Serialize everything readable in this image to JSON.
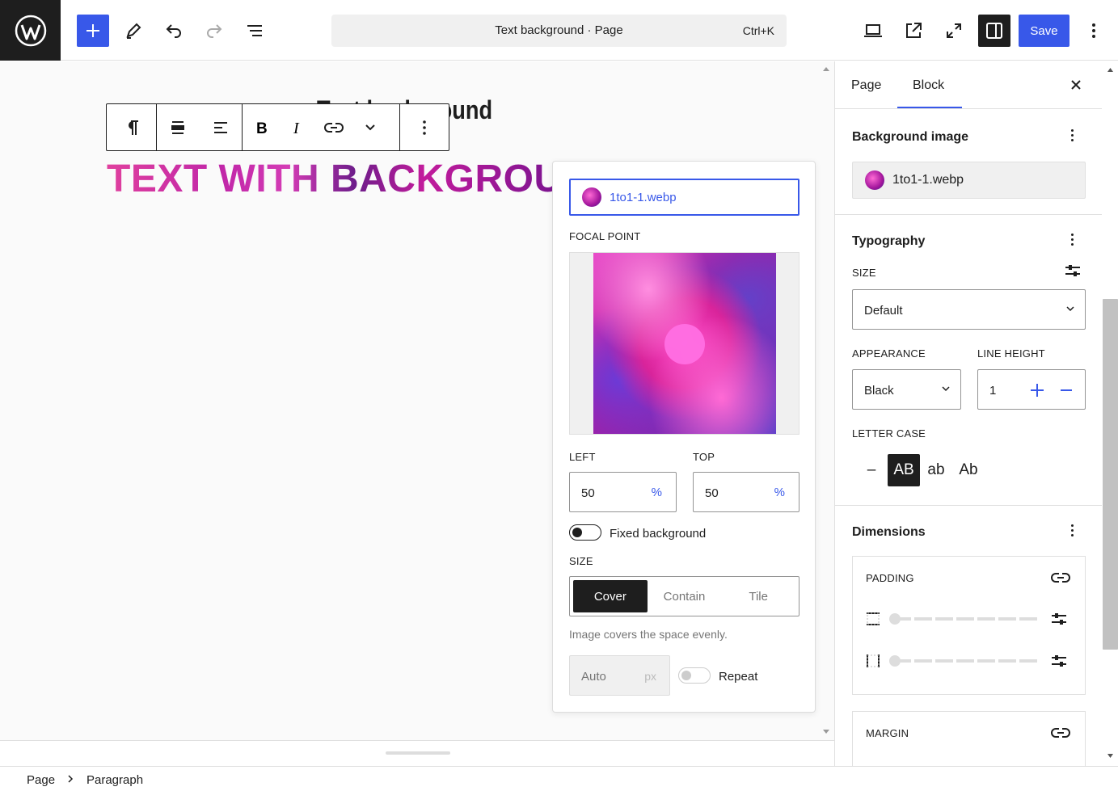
{
  "toolbar": {
    "command_title": "Text background · Page",
    "command_shortcut": "Ctrl+K",
    "save_label": "Save"
  },
  "canvas": {
    "page_title": "Text background",
    "block_text": "TEXT WITH BACKGROUND"
  },
  "popover": {
    "file_name": "1to1-1.webp",
    "focal_point_label": "FOCAL POINT",
    "left_label": "LEFT",
    "left_value": "50",
    "left_unit": "%",
    "top_label": "TOP",
    "top_value": "50",
    "top_unit": "%",
    "fixed_background_label": "Fixed background",
    "size_label": "SIZE",
    "size_options": [
      "Cover",
      "Contain",
      "Tile"
    ],
    "size_selected": "Cover",
    "size_help": "Image covers the space evenly.",
    "auto_placeholder": "Auto",
    "auto_unit": "px",
    "repeat_label": "Repeat"
  },
  "sidebar": {
    "tabs": [
      "Page",
      "Block"
    ],
    "active_tab": "Block",
    "background_image_title": "Background image",
    "background_image_file": "1to1-1.webp",
    "typography_title": "Typography",
    "size_label": "SIZE",
    "size_value": "Default",
    "appearance_label": "APPEARANCE",
    "appearance_value": "Black",
    "line_height_label": "LINE HEIGHT",
    "line_height_value": "1",
    "letter_case_label": "LETTER CASE",
    "letter_case_options": [
      "–",
      "AB",
      "ab",
      "Ab"
    ],
    "dimensions_title": "Dimensions",
    "padding_label": "PADDING",
    "margin_label": "MARGIN"
  },
  "breadcrumb": {
    "items": [
      "Page",
      "Paragraph"
    ]
  },
  "colors": {
    "accent": "#3858e9",
    "dark": "#1e1e1e"
  }
}
